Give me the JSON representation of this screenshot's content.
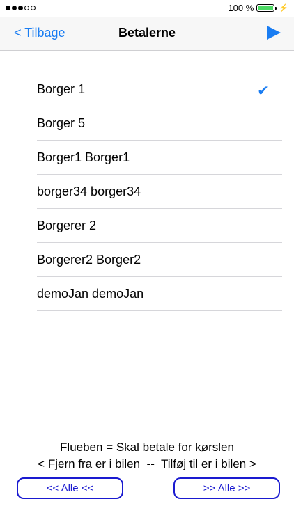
{
  "status_bar": {
    "battery_text": "100 %",
    "charging_glyph": "⚡"
  },
  "nav": {
    "back_label": "< Tilbage",
    "title": "Betalerne",
    "play_icon": "play-icon"
  },
  "rows": [
    {
      "label": "Borger 1",
      "checked": true
    },
    {
      "label": "Borger 5",
      "checked": false
    },
    {
      "label": "Borger1 Borger1",
      "checked": false
    },
    {
      "label": "borger34 borger34",
      "checked": false
    },
    {
      "label": "Borgerer 2",
      "checked": false
    },
    {
      "label": "Borgerer2 Borger2",
      "checked": false
    },
    {
      "label": "demoJan demoJan",
      "checked": false
    }
  ],
  "footer": {
    "info_line1": "Flueben = Skal betale for kørslen",
    "info_line2": "< Fjern fra er i bilen  --  Tilføj til er i bilen >",
    "remove_all_label": "<< Alle <<",
    "add_all_label": ">> Alle >>"
  },
  "colors": {
    "accent": "#1a7df2",
    "button_border": "#1a1ad0",
    "battery": "#4cd964"
  }
}
